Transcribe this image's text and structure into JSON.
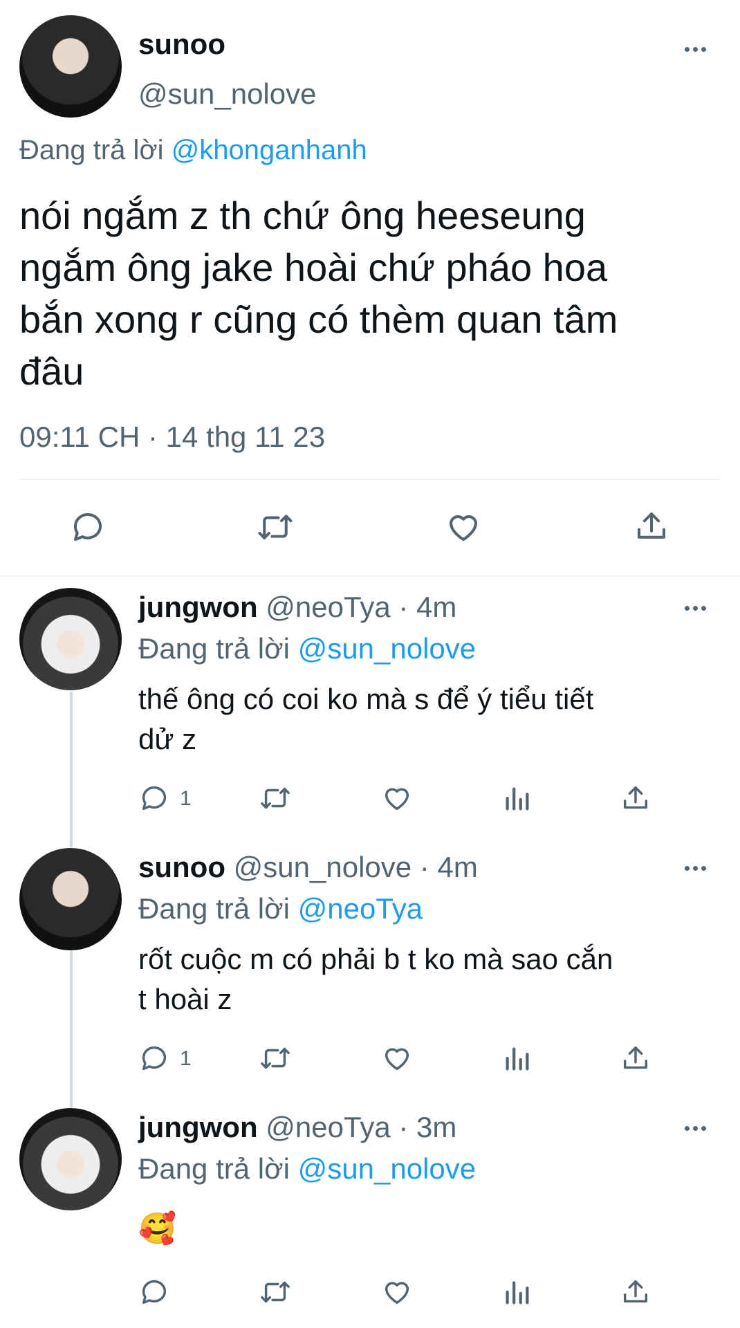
{
  "main_tweet": {
    "author_name": "sunoo",
    "author_handle": "@sun_nolove",
    "reply_prefix": "Đang trả lời",
    "reply_to": "@khonganhanh",
    "text_lines": [
      "nói ngắm z th chứ ông heeseung",
      "ngắm ông jake hoài chứ pháo hoa",
      "bắn xong r cũng có thèm quan tâm",
      "đâu"
    ],
    "timestamp": "09:11 CH · 14 thg 11 23"
  },
  "replies": [
    {
      "author_name": "jungwon",
      "author_handle": "@neoTya · 4m",
      "reply_prefix": "Đang trả lời",
      "reply_to": "@sun_nolove",
      "text_lines": [
        "thế ông có coi ko mà s để ý tiểu tiết",
        "dử z"
      ],
      "reply_count": "1"
    },
    {
      "author_name": "sunoo",
      "author_handle": "@sun_nolove · 4m",
      "reply_prefix": "Đang trả lời",
      "reply_to": "@neoTya",
      "text_lines": [
        "rốt cuộc m có phải b t ko mà sao cắn",
        "t hoài z"
      ],
      "reply_count": "1"
    },
    {
      "author_name": "jungwon",
      "author_handle": "@neoTya · 3m",
      "reply_prefix": "Đang trả lời",
      "reply_to": "@sun_nolove",
      "text_lines": [
        "🥰"
      ],
      "reply_count": ""
    }
  ],
  "icons": [
    "more-icon",
    "reply-icon",
    "retweet-icon",
    "like-icon",
    "share-icon",
    "views-icon"
  ],
  "colors": {
    "link": "#1d9bf0",
    "muted": "#536471",
    "text": "#0f1419"
  }
}
